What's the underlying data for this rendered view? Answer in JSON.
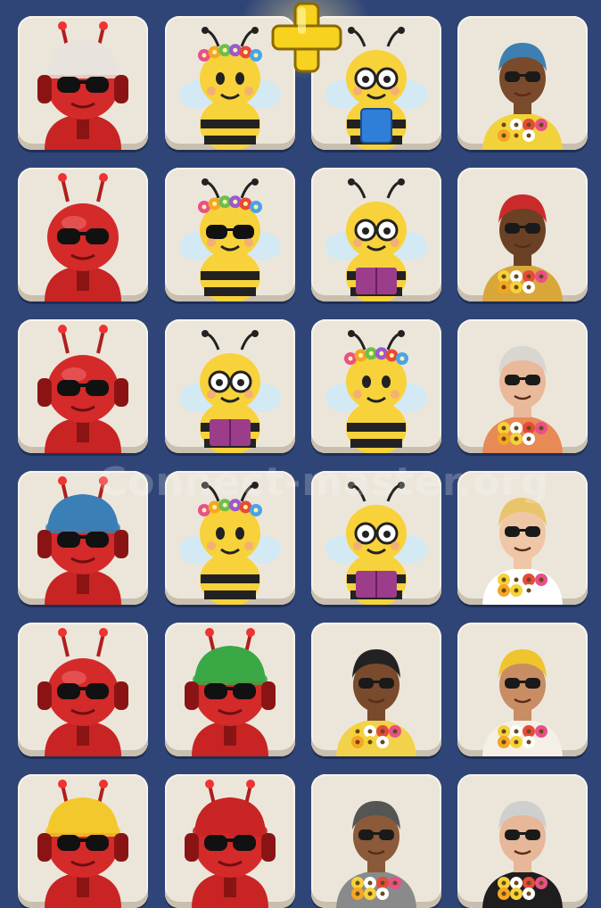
{
  "watermark": "Connect-master.org",
  "colors": {
    "background": "#2f4577",
    "tile": "#ece6da",
    "robot": "#d42a2a",
    "bee": "#f7d23a",
    "plus": "#f7d21e"
  },
  "rows": [
    [
      {
        "kind": "robot",
        "icon": "red-robot-beanie-icon",
        "hat": "#e8e3dc",
        "headphones": true,
        "label": "robot"
      },
      {
        "kind": "bee",
        "icon": "bee-flower-crown-icon",
        "crown": true,
        "glasses": false,
        "book": false,
        "label": "bee"
      },
      {
        "kind": "bee",
        "icon": "bee-glasses-tablet-icon",
        "crown": false,
        "glasses": true,
        "tablet": true,
        "label": "bee"
      },
      {
        "kind": "person",
        "icon": "person-blue-beanie-flowers-icon",
        "skin": "#7a4a2c",
        "hat": "#3d7fb0",
        "shirt": "#f2d23a",
        "label": "person"
      }
    ],
    [
      {
        "kind": "robot",
        "icon": "red-robot-antenna-icon",
        "hat": null,
        "headphones": false,
        "label": "robot"
      },
      {
        "kind": "bee",
        "icon": "bee-flower-crown-sunglasses-icon",
        "crown": true,
        "sunglasses": true,
        "label": "bee"
      },
      {
        "kind": "bee",
        "icon": "bee-glasses-book-icon",
        "crown": false,
        "glasses": true,
        "book": true,
        "label": "bee"
      },
      {
        "kind": "person",
        "icon": "person-red-beanie-sunflowers-icon",
        "skin": "#6b4125",
        "hat": "#c92b2b",
        "shirt": "#d9a63a",
        "label": "person"
      }
    ],
    [
      {
        "kind": "robot",
        "icon": "red-robot-headphones-icon",
        "hat": null,
        "headphones": true,
        "label": "robot"
      },
      {
        "kind": "bee",
        "icon": "bee-glasses-book-icon",
        "crown": false,
        "glasses": true,
        "book": true,
        "label": "bee"
      },
      {
        "kind": "bee",
        "icon": "bee-flower-crown-icon",
        "crown": true,
        "glasses": false,
        "book": false,
        "label": "bee"
      },
      {
        "kind": "person",
        "icon": "grandma-glasses-flowers-icon",
        "skin": "#e9b99a",
        "hat": "#d9d6d0",
        "shirt": "#e78a55",
        "label": "person"
      }
    ],
    [
      {
        "kind": "robot",
        "icon": "red-robot-blue-beanie-icon",
        "hat": "#3a7fb5",
        "headphones": true,
        "label": "robot"
      },
      {
        "kind": "bee",
        "icon": "bee-flower-crown-icon",
        "crown": true,
        "glasses": false,
        "book": false,
        "label": "bee"
      },
      {
        "kind": "bee",
        "icon": "bee-glasses-book-icon",
        "crown": false,
        "glasses": true,
        "book": true,
        "label": "bee"
      },
      {
        "kind": "person",
        "icon": "person-blonde-glasses-flowers-icon",
        "skin": "#f0c7a6",
        "hat": "#e9c46a",
        "shirt": "#ffffff",
        "label": "person"
      }
    ],
    [
      {
        "kind": "robot",
        "icon": "red-robot-headphones-tie-icon",
        "hat": null,
        "headphones": true,
        "label": "robot"
      },
      {
        "kind": "robot",
        "icon": "red-robot-green-beanie-waving-icon",
        "hat": "#3aa845",
        "headphones": true,
        "label": "robot"
      },
      {
        "kind": "person",
        "icon": "person-curly-hair-flowers-icon",
        "skin": "#7a4a2c",
        "hat": "#222222",
        "shirt": "#f2d24a",
        "label": "person"
      },
      {
        "kind": "person",
        "icon": "person-yellow-hat-flower-basket-icon",
        "skin": "#c98d63",
        "hat": "#f0c42c",
        "shirt": "#f5f0e6",
        "label": "person"
      }
    ],
    [
      {
        "kind": "robot",
        "icon": "red-robot-yellow-beanie-icon",
        "hat": "#f3c82c",
        "headphones": true,
        "label": "robot"
      },
      {
        "kind": "robot",
        "icon": "red-robot-helmet-visor-icon",
        "hat": "#c82424",
        "headphones": true,
        "label": "robot"
      },
      {
        "kind": "person",
        "icon": "person-grey-beanie-roses-icon",
        "skin": "#8a5a3a",
        "hat": "#555555",
        "shirt": "#8a8a8a",
        "label": "person"
      },
      {
        "kind": "person",
        "icon": "man-tuxedo-sunflowers-icon",
        "skin": "#e6b799",
        "hat": "#cfcfcf",
        "shirt": "#1e1e1e",
        "label": "person"
      }
    ]
  ]
}
